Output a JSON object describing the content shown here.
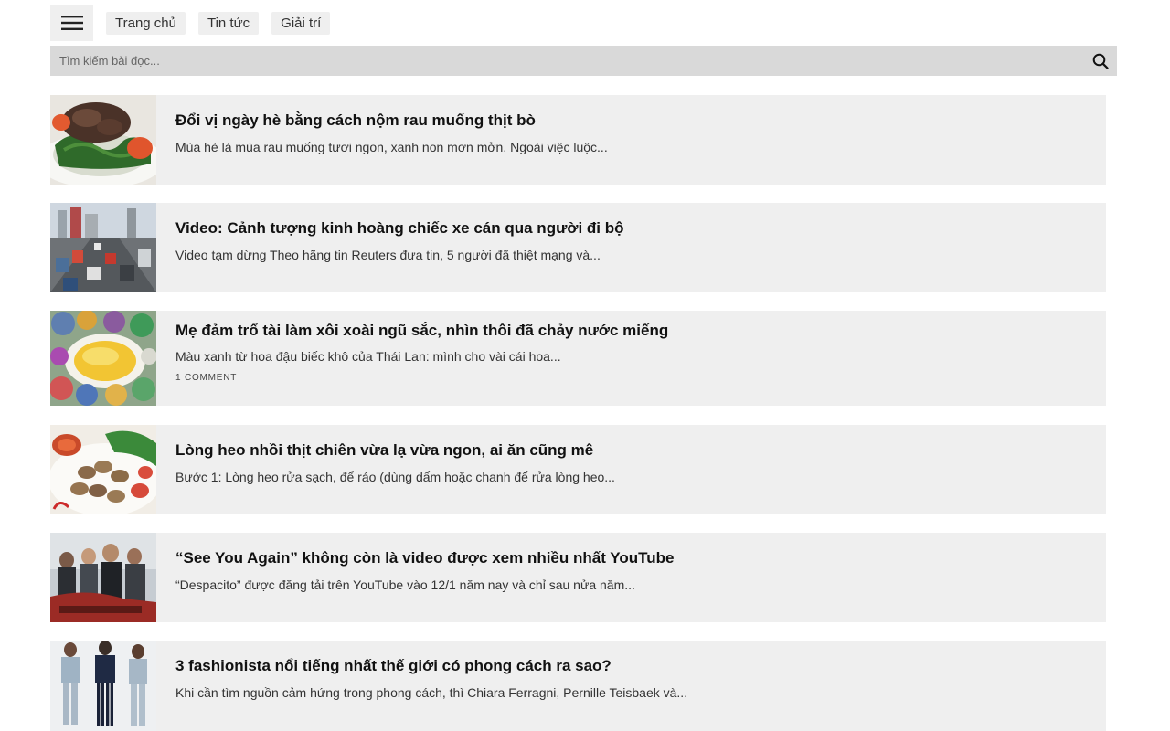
{
  "nav": {
    "menu_icon": "hamburger-icon",
    "links": [
      "Trang chủ",
      "Tin tức",
      "Giải trí"
    ]
  },
  "search": {
    "placeholder": "Tìm kiếm bài đọc...",
    "icon": "search-icon"
  },
  "articles": [
    {
      "title": "Đổi vị ngày hè bằng cách nộm rau muống thịt bò",
      "excerpt": "Mùa hè là mùa rau muống tươi ngon, xanh non mơn mởn. Ngoài việc luộc..."
    },
    {
      "title": "Video: Cảnh tượng kinh hoàng chiếc xe cán qua người đi bộ",
      "excerpt": "Video tạm dừng Theo hãng tin Reuters đưa tin, 5 người đã thiệt mạng và..."
    },
    {
      "title": "Mẹ đảm trổ tài làm xôi xoài ngũ sắc, nhìn thôi đã chảy nước miếng",
      "excerpt": "Màu xanh từ hoa đậu biếc khô của Thái Lan: mình cho vài cái hoa...",
      "comments": "1 COMMENT"
    },
    {
      "title": "Lòng heo nhồi thịt chiên vừa lạ vừa ngon, ai ăn cũng mê",
      "excerpt": "Bước 1: Lòng heo rửa sạch, để ráo (dùng dấm hoặc chanh để rửa lòng heo..."
    },
    {
      "title": "“See You Again” không còn là video được xem nhiều nhất YouTube",
      "excerpt": "“Despacito” được đăng tải trên YouTube vào 12/1 năm nay và chỉ sau nửa năm..."
    },
    {
      "title": "3 fashionista nổi tiếng nhất thế giới có phong cách ra sao?",
      "excerpt": "Khi cần tìm nguồn cảm hứng trong phong cách, thì Chiara Ferragni, Pernille Teisbaek và..."
    }
  ]
}
